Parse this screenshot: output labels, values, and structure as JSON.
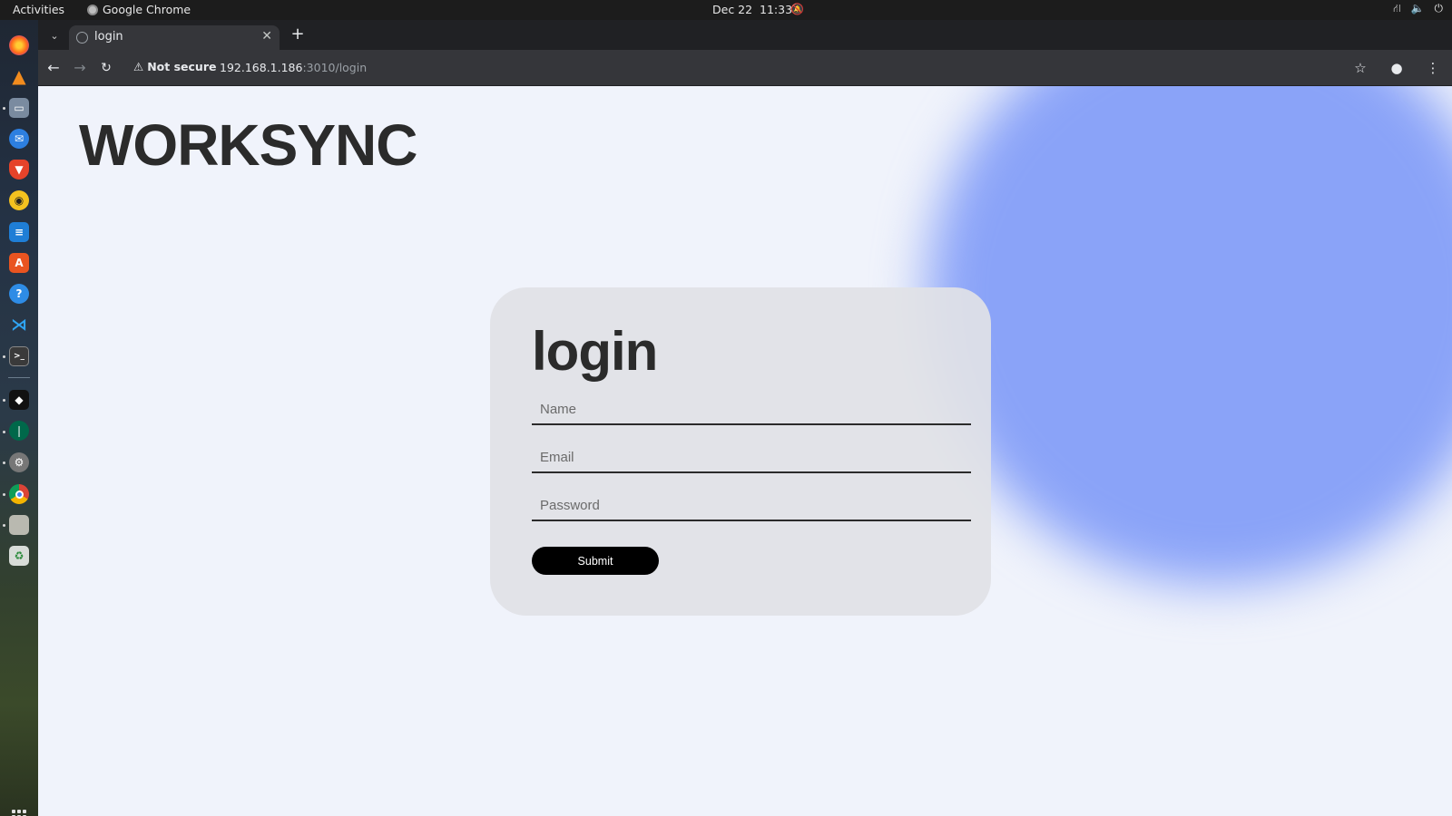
{
  "system_bar": {
    "activities": "Activities",
    "app_name": "Google Chrome",
    "date": "Dec 22",
    "time": "11:33"
  },
  "dock": {
    "items": [
      "firefox-icon",
      "vlc-icon",
      "files-icon",
      "thunderbird-icon",
      "brave-icon",
      "rhythmbox-icon",
      "writer-icon",
      "app-center-icon",
      "help-icon",
      "vscode-icon",
      "terminal-icon",
      "obsidian-icon",
      "mongodb-compass-icon",
      "settings-icon",
      "chrome-icon",
      "disk-icon",
      "trash-icon"
    ]
  },
  "browser": {
    "tab_title": "login",
    "security_label": "Not secure",
    "url_host": "192.168.1.186",
    "url_rest": ":3010/login"
  },
  "page": {
    "brand": "WORKSYNC",
    "form_title": "login",
    "name_placeholder": "Name",
    "email_placeholder": "Email",
    "password_placeholder": "Password",
    "submit_label": "Submit"
  },
  "colors": {
    "page_background": "#f0f3fb",
    "blob": "#8aa3f8",
    "card_background": "#e1e2e6",
    "submit_button": "#000000"
  }
}
